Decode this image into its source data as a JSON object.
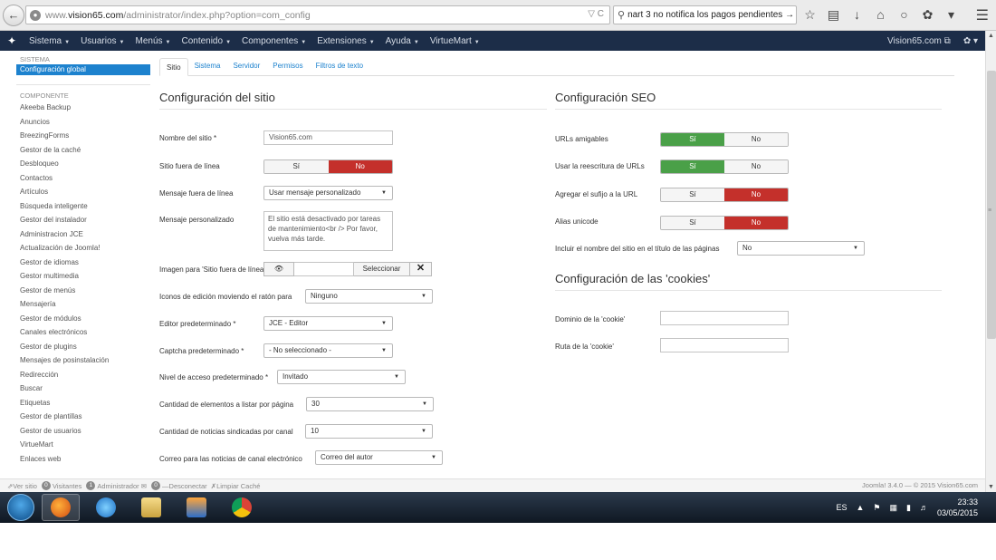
{
  "browser": {
    "url_prefix": "www.",
    "url_domain": "vision65.com",
    "url_path": "/administrator/index.php?option=com_config",
    "url_controls": "▽ C",
    "search_text": "nart 3 no notifica los pagos pendientes →"
  },
  "topnav": {
    "items": [
      "Sistema",
      "Usuarios",
      "Menús",
      "Contenido",
      "Componentes",
      "Extensiones",
      "Ayuda",
      "VirtueMart"
    ],
    "site_link": "Vision65.com ⧉",
    "settings": "✿ ▾"
  },
  "sidebar": {
    "system_heading": "SISTEMA",
    "active_item": "Configuración global",
    "component_heading": "COMPONENTE",
    "items": [
      "Akeeba Backup",
      "Anuncios",
      "BreezingForms",
      "Gestor de la caché",
      "Desbloqueo",
      "Contactos",
      "Artículos",
      "Búsqueda inteligente",
      "Gestor del instalador",
      "Administracion JCE",
      "Actualización de Joomla!",
      "Gestor de idiomas",
      "Gestor multimedia",
      "Gestor de menús",
      "Mensajería",
      "Gestor de módulos",
      "Canales electrónicos",
      "Gestor de plugins",
      "Mensajes de posinstalación",
      "Redirección",
      "Buscar",
      "Etiquetas",
      "Gestor de plantillas",
      "Gestor de usuarios",
      "VirtueMart",
      "Enlaces web"
    ]
  },
  "tabs": [
    "Sitio",
    "Sistema",
    "Servidor",
    "Permisos",
    "Filtros de texto"
  ],
  "site": {
    "title": "Configuración del sitio",
    "site_name_label": "Nombre del sitio *",
    "site_name_value": "Vision65.com",
    "offline_label": "Sitio fuera de línea",
    "yes": "Sí",
    "no": "No",
    "offline_msg_label": "Mensaje fuera de línea",
    "offline_msg_value": "Usar mensaje personalizado",
    "custom_msg_label": "Mensaje personalizado",
    "custom_msg_value": "El sitio está desactivado por tareas de mantenimiento<br /> Por favor, vuelva más tarde.",
    "offline_image_label": "Imagen para 'Sitio fuera de línea'",
    "preview_icon": "👁",
    "select_btn": "Seleccionar",
    "clear_btn": "✕",
    "edit_icons_label": "Iconos de edición moviendo el ratón para",
    "edit_icons_value": "Ninguno",
    "editor_label": "Editor predeterminado *",
    "editor_value": "JCE - Editor",
    "captcha_label": "Captcha predeterminado *",
    "captcha_value": "- No seleccionado -",
    "access_label": "Nivel de acceso predeterminado *",
    "access_value": "Invitado",
    "list_limit_label": "Cantidad de elementos a listar por página",
    "list_limit_value": "30",
    "feed_limit_label": "Cantidad de noticias sindicadas por canal",
    "feed_limit_value": "10",
    "feed_email_label": "Correo para las noticias de canal electrónico",
    "feed_email_value": "Correo del autor"
  },
  "seo": {
    "title": "Configuración SEO",
    "sef_label": "URLs amigables",
    "rewrite_label": "Usar la reescritura de URLs",
    "suffix_label": "Agregar el sufijo a la URL",
    "unicode_label": "Alias unicode",
    "sitename_label": "Incluir el nombre del sitio en el título de las páginas",
    "sitename_value": "No"
  },
  "cookies": {
    "title": "Configuración de las 'cookies'",
    "domain_label": "Dominio de la 'cookie'",
    "path_label": "Ruta de la 'cookie'"
  },
  "statusbar": {
    "view_site": "Ver sitio",
    "visitors_count": "0",
    "visitors": "Visitantes",
    "admins_count": "1",
    "admins": "Administrador",
    "messages_count": "0",
    "logout": "Desconectar",
    "clear_cache": "Limpiar Caché",
    "version": "Joomla! 3.4.0 — © 2015 Vision65.com"
  },
  "taskbar": {
    "language": "ES",
    "time": "23:33",
    "date": "03/05/2015"
  },
  "colors": {
    "nav_bg": "#1c2d48",
    "accent_blue": "#1d82ce",
    "toggle_green": "#4aa048",
    "toggle_red": "#c4302b"
  }
}
